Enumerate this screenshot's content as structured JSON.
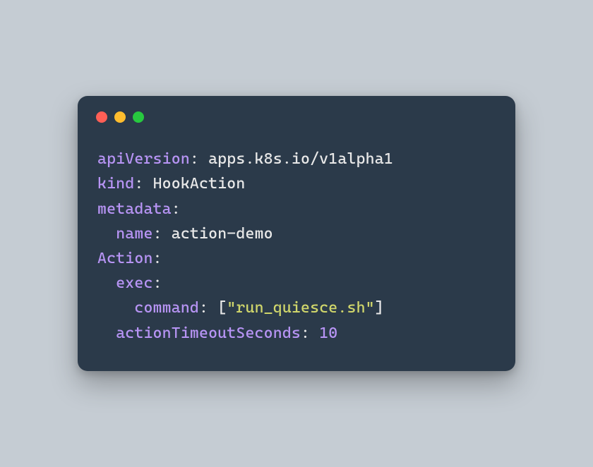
{
  "yaml": {
    "apiVersion_key": "apiVersion",
    "apiVersion_val": "apps.k8s.io/v1alpha1",
    "kind_key": "kind",
    "kind_val": "HookAction",
    "metadata_key": "metadata",
    "metadata_name_key": "name",
    "metadata_name_val": "action-demo",
    "action_key": "Action",
    "exec_key": "exec",
    "command_key": "command",
    "command_open": "[",
    "command_val": "\"run_quiesce.sh\"",
    "command_close": "]",
    "timeout_key": "actionTimeoutSeconds",
    "timeout_val": "10",
    "colon": ":",
    "space": " ",
    "indent1": "  ",
    "indent2": "    "
  },
  "colors": {
    "background": "#c5ccd3",
    "window": "#2b3a4a",
    "key": "#b794f4",
    "string": "#d0d66b",
    "text": "#e8e8e8"
  }
}
